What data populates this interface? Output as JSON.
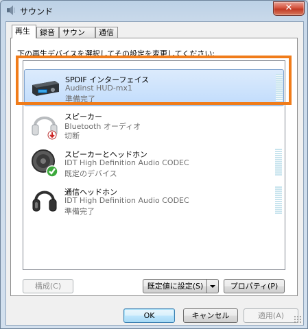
{
  "window": {
    "title": "サウンド",
    "close_label": "✕"
  },
  "tabs": [
    {
      "label": "再生",
      "active": true
    },
    {
      "label": "録音",
      "active": false
    },
    {
      "label": "サウンド",
      "active": false
    },
    {
      "label": "通信",
      "active": false
    }
  ],
  "instruction": "下の再生デバイスを選択してその設定を変更してください:",
  "devices": [
    {
      "name": "SPDIF インターフェイス",
      "detail": "Audinst HUD-mx1",
      "status": "準備完了",
      "icon": "spdif-device-icon",
      "selected": true
    },
    {
      "name": "スピーカー",
      "detail": "Bluetooth オーディオ",
      "status": "切断",
      "icon": "bluetooth-headphones-icon",
      "selected": false
    },
    {
      "name": "スピーカーとヘッドホン",
      "detail": "IDT High Definition Audio CODEC",
      "status": "既定のデバイス",
      "icon": "speaker-default-icon",
      "selected": false
    },
    {
      "name": "通信ヘッドホン",
      "detail": "IDT High Definition Audio CODEC",
      "status": "準備完了",
      "icon": "headphones-icon",
      "selected": false
    }
  ],
  "buttons": {
    "configure": "構成(C)",
    "set_default": "既定値に設定(S)",
    "properties": "プロパティ(P)",
    "ok": "OK",
    "cancel": "キャンセル",
    "apply": "適用(A)"
  },
  "colors": {
    "highlight": "#f07c1a",
    "selection": "#c1dcfc",
    "close": "#c13b25"
  }
}
